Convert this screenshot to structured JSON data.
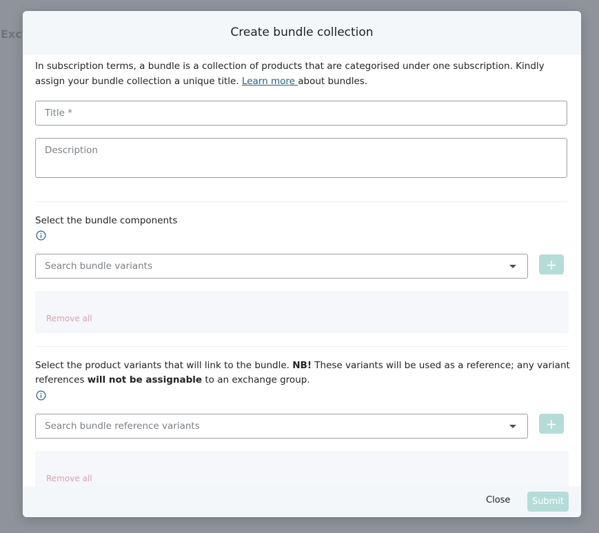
{
  "background": {
    "text": "Exch"
  },
  "modal": {
    "title": "Create bundle collection",
    "intro": {
      "before": "In subscription terms, a bundle is a collection of products that are categorised under one subscription. Kindly assign your bundle collection a unique title. ",
      "link": "Learn more ",
      "after": "about bundles."
    },
    "title_field": {
      "placeholder": "Title *"
    },
    "description_field": {
      "placeholder": "Description"
    },
    "components": {
      "label": "Select the bundle components",
      "search_placeholder": "Search bundle variants",
      "add_label": "+",
      "remove_all": "Remove all"
    },
    "references": {
      "label_1": "Select the product variants that will link to the bundle. ",
      "label_bold_1": "NB!",
      "label_2": " These variants will be used as a reference; any variant references ",
      "label_bold_2": "will not be assignable",
      "label_3": " to an exchange group.",
      "search_placeholder": "Search bundle reference variants",
      "add_label": "+",
      "remove_all": "Remove all"
    },
    "footer": {
      "close": "Close",
      "submit": "Submit"
    }
  },
  "colors": {
    "overlay": "#8f939c",
    "accent_disabled": "#b4dcd8",
    "link": "#1f5f86",
    "remove_all": "#d6a3ad"
  }
}
